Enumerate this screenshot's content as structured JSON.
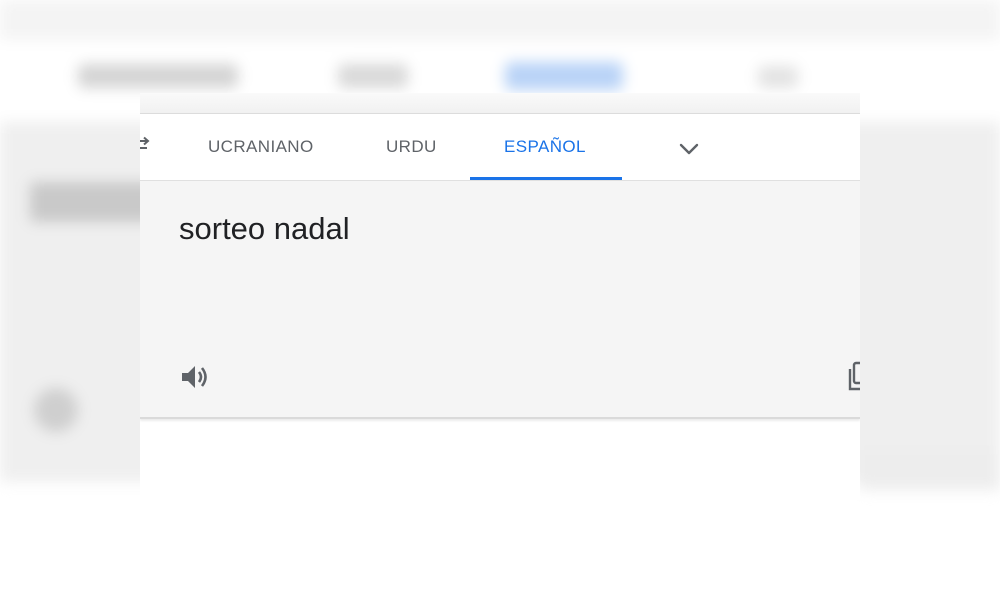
{
  "language_tabs": [
    {
      "label": "UCRANIANO",
      "active": false
    },
    {
      "label": "URDU",
      "active": false
    },
    {
      "label": "ESPAÑOL",
      "active": true
    }
  ],
  "translation": {
    "text": "sorteo nadal"
  },
  "icons": {
    "swap": "swap-arrows-icon",
    "more_languages": "chevron-down-icon",
    "listen": "speaker-icon",
    "copy": "copy-icon"
  },
  "colors": {
    "accent": "#1a73e8",
    "tab_text": "#5f6368",
    "result_background": "#f5f5f5",
    "result_text": "#202124"
  }
}
